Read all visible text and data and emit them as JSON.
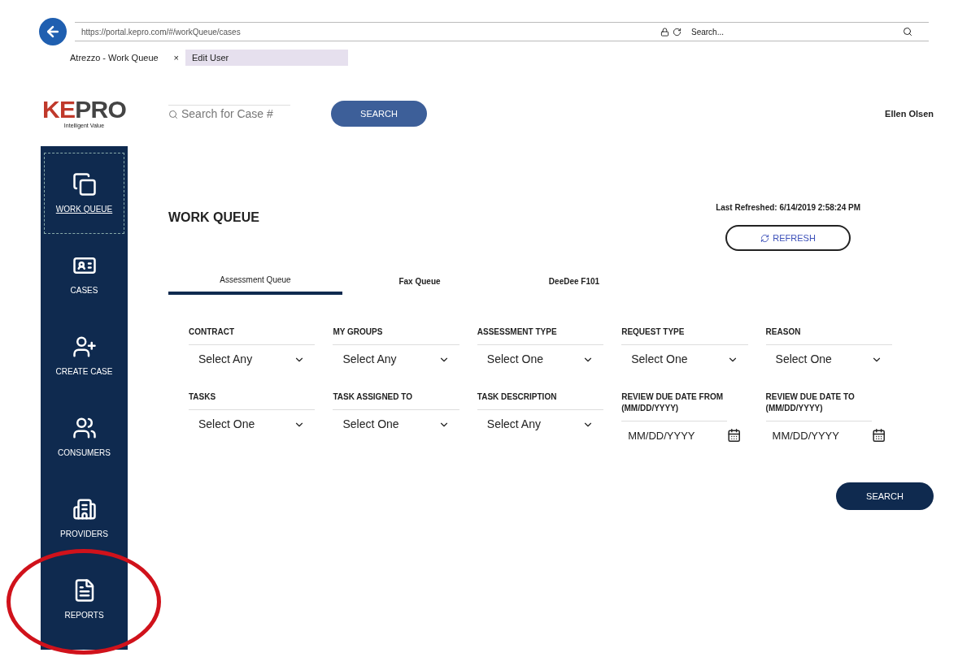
{
  "browser": {
    "url": "https://portal.kepro.com/#/workQueue/cases",
    "search_placeholder": "Search...",
    "tabs": [
      {
        "label": "Atrezzo - Work Queue",
        "selected": true,
        "close": "×"
      },
      {
        "label": "Edit User",
        "selected": false
      }
    ]
  },
  "header": {
    "logo": "KEPRO",
    "tagline": "Intelligent Value",
    "search_placeholder": "Search for Case #",
    "search_button": "SEARCH",
    "user": "Ellen Olsen"
  },
  "sidebar": {
    "items": [
      {
        "label": "WORK QUEUE",
        "selected": true,
        "circled": false
      },
      {
        "label": "CASES",
        "selected": false,
        "circled": false
      },
      {
        "label": "CREATE CASE",
        "selected": false,
        "circled": false
      },
      {
        "label": "CONSUMERS",
        "selected": false,
        "circled": false
      },
      {
        "label": "PROVIDERS",
        "selected": false,
        "circled": false
      },
      {
        "label": "REPORTS",
        "selected": false,
        "circled": true
      }
    ]
  },
  "page": {
    "title": "WORK QUEUE",
    "last_refreshed": "Last Refreshed: 6/14/2019 2:58:24 PM",
    "refresh_button": "REFRESH",
    "tabs": [
      {
        "label": "Assessment Queue",
        "selected": true
      },
      {
        "label": "Fax Queue",
        "selected": false
      },
      {
        "label": "DeeDee F101",
        "selected": false
      }
    ],
    "filters": [
      {
        "kind": "select",
        "label": "CONTRACT",
        "value": "Select Any"
      },
      {
        "kind": "select",
        "label": "MY GROUPS",
        "value": "Select Any"
      },
      {
        "kind": "select",
        "label": "ASSESSMENT TYPE",
        "value": "Select One"
      },
      {
        "kind": "select",
        "label": "REQUEST TYPE",
        "value": "Select One"
      },
      {
        "kind": "select",
        "label": "REASON",
        "value": "Select One"
      },
      {
        "kind": "select",
        "label": "TASKS",
        "value": "Select One"
      },
      {
        "kind": "select",
        "label": "TASK ASSIGNED TO",
        "value": "Select One"
      },
      {
        "kind": "select",
        "label": "TASK DESCRIPTION",
        "value": "Select Any"
      },
      {
        "kind": "date",
        "label": "REVIEW DUE DATE FROM (MM/DD/YYYY)",
        "placeholder": "MM/DD/YYYY"
      },
      {
        "kind": "date",
        "label": "REVIEW DUE DATE TO (MM/DD/YYYY)",
        "placeholder": "MM/DD/YYYY"
      }
    ],
    "search_button": "SEARCH"
  }
}
